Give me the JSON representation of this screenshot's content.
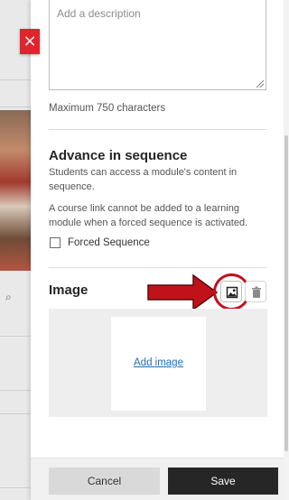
{
  "description": {
    "placeholder": "Add a description",
    "max_chars_hint": "Maximum 750 characters"
  },
  "sequence": {
    "heading": "Advance in sequence",
    "text1": "Students can access a module's content in sequence.",
    "text2": "A course link cannot be added to a learning module when a forced sequence is activated.",
    "checkbox_label": "Forced Sequence",
    "checked": false
  },
  "image": {
    "heading": "Image",
    "add_label": "Add image"
  },
  "footer": {
    "cancel_label": "Cancel",
    "save_label": "Save"
  },
  "colors": {
    "accent_red": "#c1121c",
    "link_blue": "#1c6fb5",
    "save_bg": "#262626",
    "close_red": "#e0242e"
  },
  "icons": [
    "close-icon",
    "search-icon",
    "image-icon",
    "trash-icon",
    "red-arrow-icon"
  ]
}
